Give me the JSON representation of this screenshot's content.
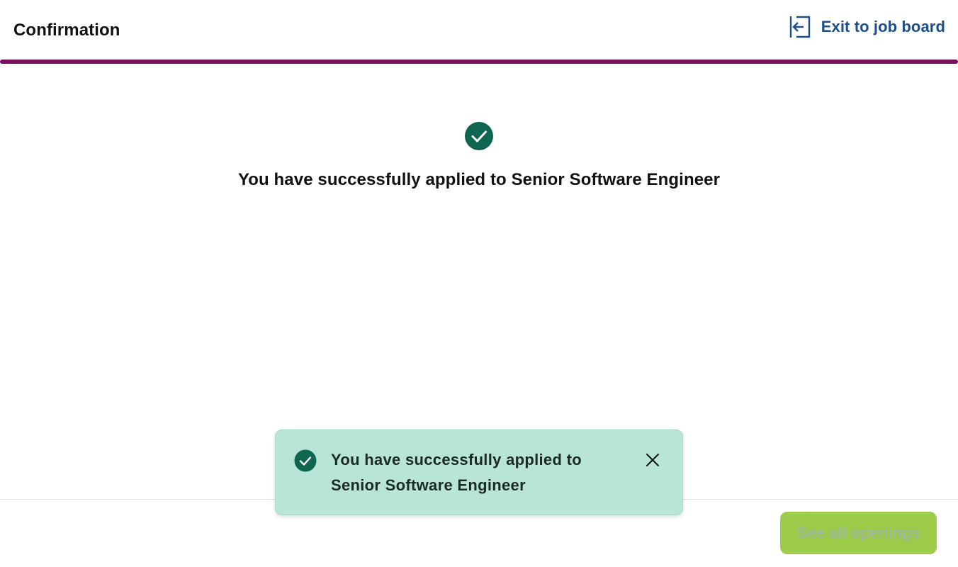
{
  "colors": {
    "accent": "#1d4e89",
    "brand": "#7a0f5e",
    "success": "#0e6650",
    "toast_bg": "#b9e5d9",
    "button_bg": "#9ccc4a"
  },
  "header": {
    "title": "Confirmation",
    "exit_link": {
      "label": "Exit to job board",
      "icon": "exit-icon"
    }
  },
  "main": {
    "icon": "check-circle-icon",
    "message": "You have successfully applied to Senior Software Engineer"
  },
  "toast": {
    "icon": "check-circle-icon",
    "message": "You have successfully applied to Senior Software Engineer",
    "close_icon": "close-icon"
  },
  "footer": {
    "button_label": "See all openings"
  }
}
